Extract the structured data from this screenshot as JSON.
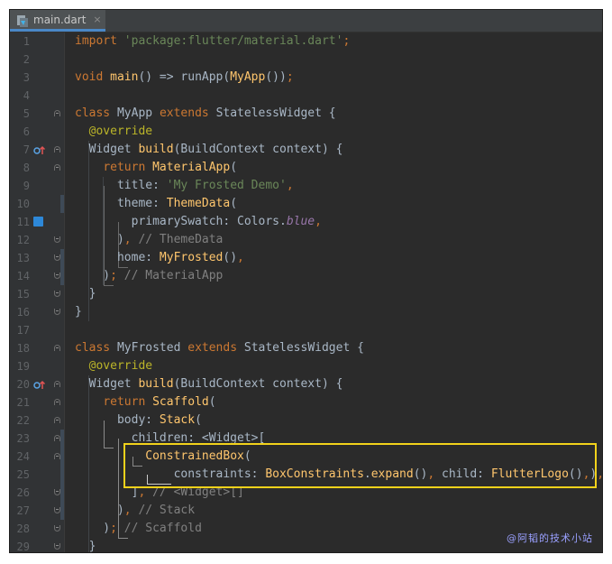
{
  "tab": {
    "title": "main.dart",
    "close": "×"
  },
  "lines": [
    {
      "n": "1",
      "html": "<span class=\"kw\">import </span><span class=\"str\">'package:flutter/material.dart'</span><span class=\"kw\">;</span>"
    },
    {
      "n": "2",
      "html": ""
    },
    {
      "n": "3",
      "html": "<span class=\"kw\">void </span><span class=\"fn\">main</span>() => runApp(<span class=\"fn\">MyApp</span>())<span class=\"kw\">;</span>"
    },
    {
      "n": "4",
      "html": ""
    },
    {
      "n": "5",
      "html": "<span class=\"kw\">class </span>MyApp <span class=\"kw\">extends </span>StatelessWidget {"
    },
    {
      "n": "6",
      "html": "  <span class=\"ann\">@override</span>"
    },
    {
      "n": "7",
      "html": "  Widget <span class=\"fn\">build</span>(BuildContext context) {"
    },
    {
      "n": "8",
      "html": "    <span class=\"kw\">return </span><span class=\"fn\">MaterialApp</span>("
    },
    {
      "n": "9",
      "html": "      title: <span class=\"str\">'My Frosted Demo'</span><span class=\"kw\">,</span>"
    },
    {
      "n": "10",
      "html": "      theme: <span class=\"fn\">ThemeData</span>("
    },
    {
      "n": "11",
      "html": "        primarySwatch: Colors.<span class=\"it\">blue</span><span class=\"kw\">,</span>"
    },
    {
      "n": "12",
      "html": "      )<span class=\"kw\">, </span><span class=\"cmt\">// ThemeData</span>"
    },
    {
      "n": "13",
      "html": "      home: <span class=\"fn\">MyFrosted</span>()<span class=\"kw\">,</span>"
    },
    {
      "n": "14",
      "html": "    )<span class=\"kw\">; </span><span class=\"cmt\">// MaterialApp</span>"
    },
    {
      "n": "15",
      "html": "  }"
    },
    {
      "n": "16",
      "html": "}"
    },
    {
      "n": "17",
      "html": ""
    },
    {
      "n": "18",
      "html": "<span class=\"kw\">class </span>MyFrosted <span class=\"kw\">extends </span>StatelessWidget {"
    },
    {
      "n": "19",
      "html": "  <span class=\"ann\">@override</span>"
    },
    {
      "n": "20",
      "html": "  Widget <span class=\"fn\">build</span>(BuildContext context) {"
    },
    {
      "n": "21",
      "html": "    <span class=\"kw\">return </span><span class=\"fn\">Scaffold</span>("
    },
    {
      "n": "22",
      "html": "      body: <span class=\"fn\">Stack</span>("
    },
    {
      "n": "23",
      "html": "        children: &lt;Widget&gt;["
    },
    {
      "n": "24",
      "html": "          <span class=\"fn\">ConstrainedBox</span>("
    },
    {
      "n": "25",
      "html": "              constraints: <span class=\"fn\">BoxConstraints</span>.<span class=\"fn\">expand</span>()<span class=\"kw\">, </span>child: <span class=\"fn\">FlutterLogo</span>()<span class=\"kw\">,</span>)<span class=\"kw\">,</span>"
    },
    {
      "n": "26",
      "html": "        ]<span class=\"kw\">, </span><span class=\"cmt\">// &lt;Widget&gt;[]</span>"
    },
    {
      "n": "27",
      "html": "      )<span class=\"kw\">, </span><span class=\"cmt\">// Stack</span>"
    },
    {
      "n": "28",
      "html": "    )<span class=\"kw\">; </span><span class=\"cmt\">// Scaffold</span>"
    },
    {
      "n": "29",
      "html": "  }"
    }
  ],
  "watermark": "@阿韬的技术小站",
  "colors": {
    "accent": "#4a88c7",
    "highlight": "#f2d21b",
    "background": "#2b2b2b"
  }
}
